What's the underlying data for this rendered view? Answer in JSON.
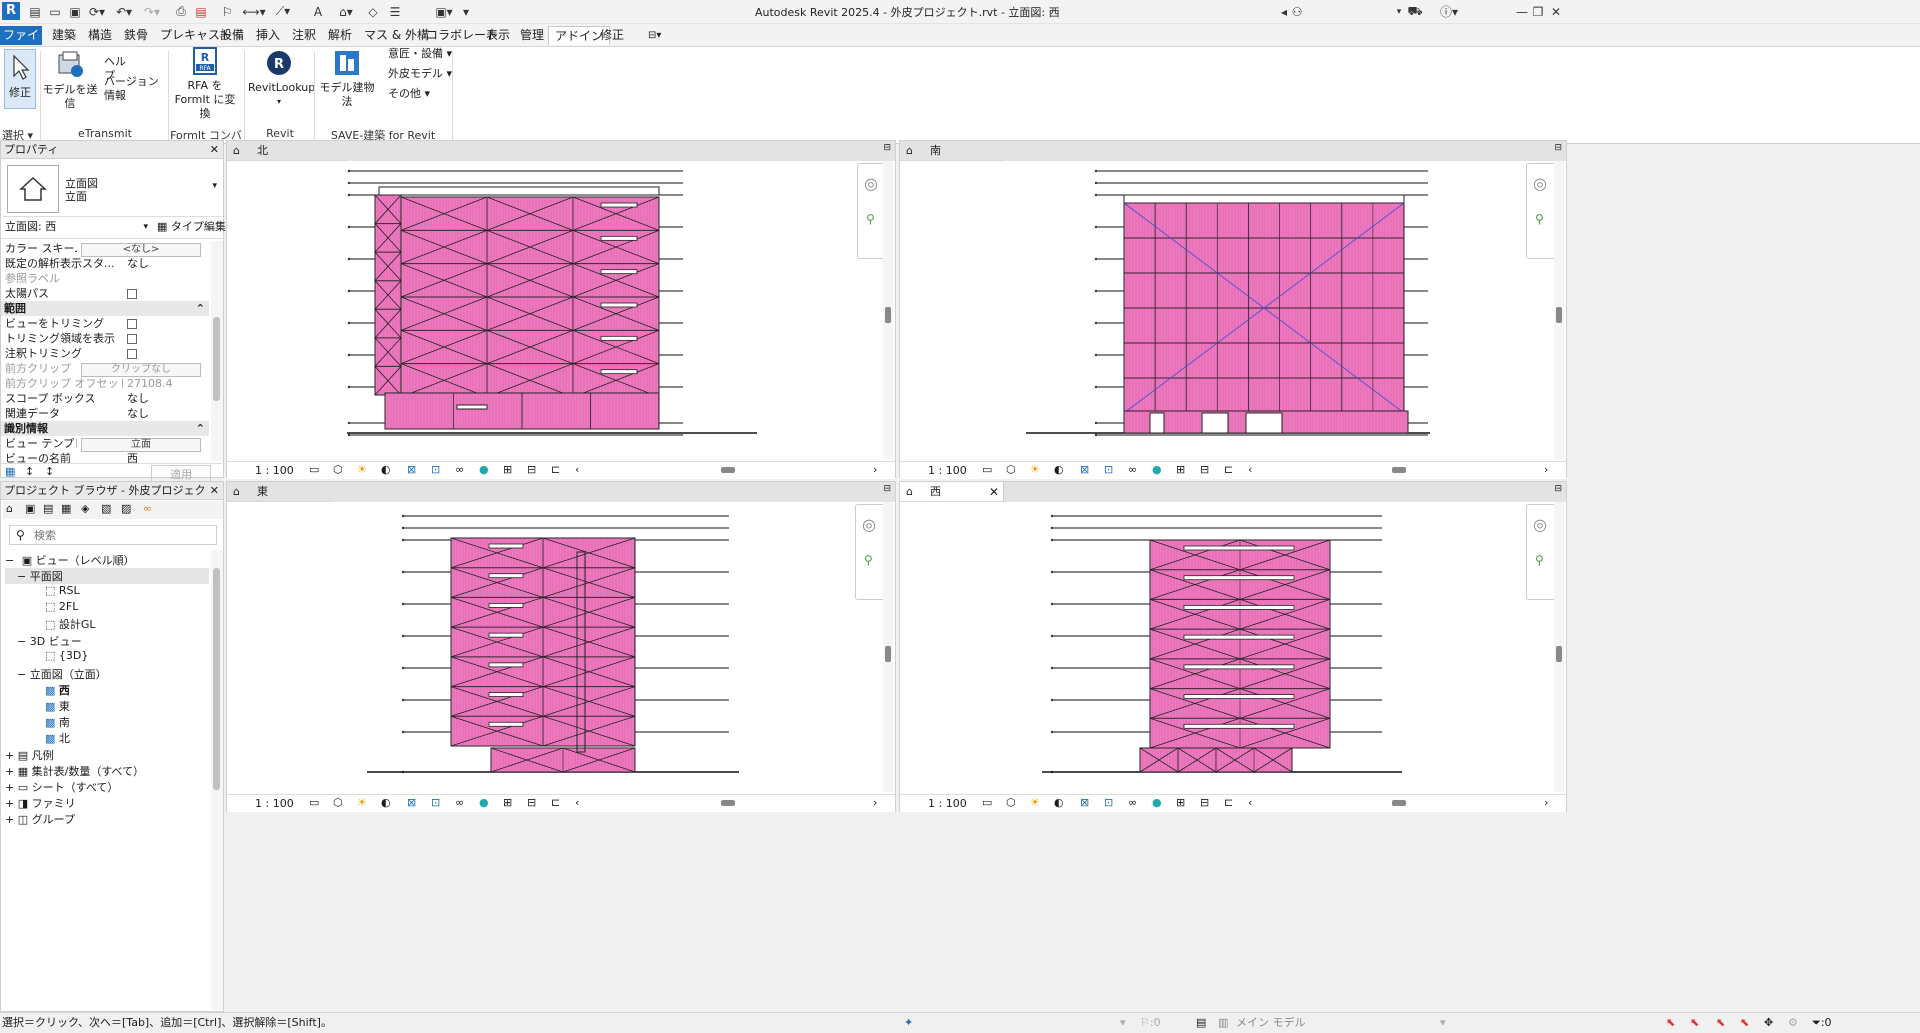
{
  "titlebar": {
    "title": "Autodesk Revit 2025.4 - 外皮プロジェクト.rvt - 立面図: 西"
  },
  "tabs": [
    "ファイル",
    "建築",
    "構造",
    "鉄骨",
    "プレキャスト",
    "設備",
    "挿入",
    "注釈",
    "解析",
    "マス & 外構",
    "コラボレート",
    "表示",
    "管理",
    "アドイン",
    "修正"
  ],
  "active_tab": "アドイン",
  "ribbon": {
    "modify": "修正",
    "select": "選択",
    "send_model": "モデルを送信",
    "help": "ヘルプ",
    "version_info": "バージョン情報",
    "etransmit": "eTransmit",
    "rfa_convert_1": "RFA を",
    "rfa_convert_2": "FormIt に変換",
    "formit_converter": "FormIt コンバータ",
    "revitlookup_btn": "RevitLookup",
    "revitlookup_panel": "Revit Lookup",
    "model_building_law": "モデル建物法",
    "design_equipment": "意匠・設備",
    "exterior_model": "外皮モデル",
    "other": "その他",
    "save_panel": "SAVE-建築 for Revit"
  },
  "properties": {
    "header": "プロパティ",
    "type_line1": "立面図",
    "type_line2": "立面",
    "view_selector": "立面図: 西",
    "type_edit": "タイプ編集",
    "rows": [
      {
        "k": "カラー スキーム",
        "v": "<なし>",
        "kind": "btn"
      },
      {
        "k": "既定の解析表示スタ...",
        "v": "なし"
      },
      {
        "k": "参照ラベル",
        "v": "",
        "dim": true
      },
      {
        "k": "太陽パス",
        "v": "",
        "kind": "chk"
      }
    ],
    "group_range": "範囲",
    "range_rows": [
      {
        "k": "ビューをトリミング",
        "kind": "chk"
      },
      {
        "k": "トリミング領域を表示",
        "kind": "chk"
      },
      {
        "k": "注釈トリミング",
        "kind": "chk"
      },
      {
        "k": "前方クリップ",
        "v": "クリップなし",
        "kind": "btn",
        "dim": true
      },
      {
        "k": "前方クリップ オフセット",
        "v": "27108.4",
        "dim": true
      },
      {
        "k": "スコープ ボックス",
        "v": "なし"
      },
      {
        "k": "関連データ",
        "v": "なし"
      }
    ],
    "group_ident": "識別情報",
    "ident_rows": [
      {
        "k": "ビュー テンプレート",
        "v": "立面",
        "kind": "btn"
      },
      {
        "k": "ビューの名前",
        "v": "西"
      }
    ],
    "apply": "適用"
  },
  "browser": {
    "header": "プロジェクト ブラウザ - 外皮プロジェクト.rvt",
    "search_placeholder": "検索",
    "views_root": "ビュー（レベル順）",
    "floor_plans": "平面図",
    "fp_items": [
      "RSL",
      "2FL",
      "設計GL"
    ],
    "views_3d": "3D ビュー",
    "v3d_items": [
      "{3D}"
    ],
    "elevations": "立面図（立面）",
    "elev_items": [
      "西",
      "東",
      "南",
      "北"
    ],
    "legend": "凡例",
    "schedules": "集計表/数量（すべて）",
    "sheets": "シート（すべて）",
    "families": "ファミリ",
    "groups": "グループ"
  },
  "views": {
    "north": "北",
    "south": "南",
    "east": "東",
    "west": "西",
    "scale": "1 : 100"
  },
  "status": {
    "hint": "選択＝クリック、次へ＝[Tab]、追加＝[Ctrl]、選択解除＝[Shift]。",
    "workset": ":0",
    "main_model": "メイン モデル",
    "filter_count": ":0"
  },
  "colors": {
    "wall": "#f07ac0",
    "accent": "#1e6fbf"
  }
}
